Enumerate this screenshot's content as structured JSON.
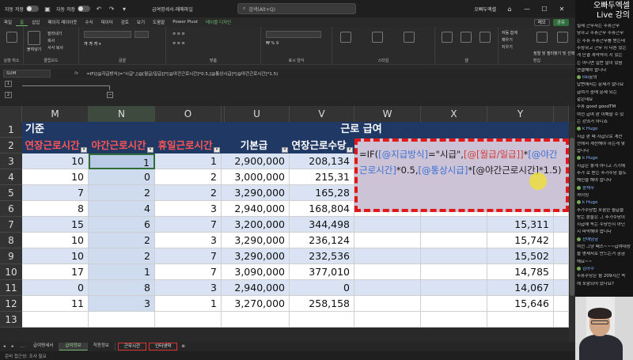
{
  "titlebar": {
    "autosave_label": "자동 저장",
    "autosave2_label": "자동 저장",
    "filename": "급여명세서-매매파일",
    "search_placeholder": "검색(Alt+Q)",
    "user": "오빠두엑셀"
  },
  "menu": [
    "파일",
    "홈",
    "삽입",
    "페이지 레이아웃",
    "수식",
    "데이터",
    "검토",
    "보기",
    "도움말",
    "Power Pivot",
    "테이블 디자인"
  ],
  "menu_active_index": 1,
  "menu_right": {
    "comment": "메모",
    "share": "공유"
  },
  "ribbon": {
    "groups": [
      {
        "label": "실행 취소",
        "buttons": []
      },
      {
        "label": "클립보드",
        "buttons": [
          "붙여넣기",
          "잘라내기",
          "복사",
          "서식 복사"
        ]
      },
      {
        "label": "글꼴",
        "buttons": []
      },
      {
        "label": "맞춤",
        "buttons": []
      },
      {
        "label": "표시 형식",
        "buttons": []
      },
      {
        "label": "스타일",
        "buttons": []
      },
      {
        "label": "셀",
        "buttons": []
      },
      {
        "label": "편집",
        "buttons": [
          "자동 합계",
          "채우기",
          "지우기",
          "정렬 및 필터",
          "찾기 및 선택"
        ]
      }
    ]
  },
  "formula_bar": {
    "name_box": "SUM",
    "fx": "fx",
    "formula": "=IF([@지급방식]=\"시급\",[@[월급/일급]]*[@야간근로시간]*0.5,[@통상시급]*[@야간근로시간]*1.5)"
  },
  "outline": {
    "levels": [
      "1",
      "2"
    ]
  },
  "columns": [
    "M",
    "N",
    "O",
    "T",
    "U",
    "V",
    "W",
    "X",
    "Y"
  ],
  "selected_column": "N",
  "row_numbers": [
    "1",
    "2",
    "3",
    "4",
    "5",
    "6",
    "7",
    "8",
    "9",
    "10",
    "11",
    "12",
    "13"
  ],
  "row1": {
    "section_left": "기준",
    "section_right": "근로 급여"
  },
  "headers": {
    "M": "연장근로시간",
    "N": "야간근로시간",
    "O": "휴일근로시간",
    "U": "기본급",
    "V": "연장근로수당"
  },
  "table": {
    "rows": [
      {
        "M": "10",
        "N": "1",
        "O": "1",
        "U": "2,900,000",
        "V": "208,134",
        "Y": ""
      },
      {
        "M": "10",
        "N": "0",
        "O": "2",
        "U": "3,000,000",
        "V": "215,31",
        "Y": ""
      },
      {
        "M": "7",
        "N": "2",
        "O": "2",
        "U": "3,290,000",
        "V": "165,28",
        "Y": ""
      },
      {
        "M": "8",
        "N": "4",
        "O": "3",
        "U": "2,940,000",
        "V": "168,804",
        "Y": ""
      },
      {
        "M": "15",
        "N": "6",
        "O": "7",
        "U": "3,200,000",
        "V": "344,498",
        "Y": "15,311"
      },
      {
        "M": "10",
        "N": "2",
        "O": "3",
        "U": "3,290,000",
        "V": "236,124",
        "Y": "15,742"
      },
      {
        "M": "10",
        "N": "2",
        "O": "7",
        "U": "3,290,000",
        "V": "232,536",
        "Y": "15,502"
      },
      {
        "M": "17",
        "N": "1",
        "O": "7",
        "U": "3,090,000",
        "V": "377,010",
        "Y": "14,785"
      },
      {
        "M": "0",
        "N": "8",
        "O": "3",
        "U": "2,940,000",
        "V": "0",
        "Y": "14,067"
      },
      {
        "M": "11",
        "N": "3",
        "O": "1",
        "U": "3,270,000",
        "V": "258,158",
        "Y": "15,646"
      }
    ]
  },
  "callout": {
    "p1": "=IF(",
    "r1": "[@지급방식]",
    "p2": "=\"시급\",",
    "r2": "[@[월급/일급]]",
    "p3": "*",
    "r3": "[@야간근로시간]",
    "p4": "*0.5,",
    "r4": "[@통상시급]",
    "p5": "*[@야간근로시간]*1.5)"
  },
  "sheet_tabs": [
    "급여명세서",
    "급여정보",
    "직원정보",
    "근무시간",
    "인터넷약"
  ],
  "sheet_active_index": 1,
  "status": "준비  접근성: 조사 필요",
  "live": {
    "title1": "오빠두엑셀",
    "title2": "Live 강의"
  },
  "chat": [
    {
      "user": "",
      "text": "실제 근무자는 주휴근무"
    },
    {
      "user": "",
      "text": "당하고 주휴근무 주휴근무"
    },
    {
      "user": "",
      "text": "는 주휴 주휴근무를 받는데"
    },
    {
      "user": "",
      "text": "주장하고 근무 시 다른 있는"
    },
    {
      "user": "",
      "text": "게 단결 계약적이 시 있는"
    },
    {
      "user": "",
      "text": "는 아니면 일반 말이 있음"
    },
    {
      "user": "",
      "text": "연결해야 합니다"
    },
    {
      "user": "tiki",
      "text": "문의"
    },
    {
      "user": "",
      "text": "답변에서는 문제가 없나요"
    },
    {
      "user": "",
      "text": "급여가 중에 문제 되는"
    },
    {
      "user": "",
      "text": "같은데요"
    },
    {
      "user": "",
      "text": "주휴 good goodTM"
    },
    {
      "user": "",
      "text": "여전 급여 판 이해할 수 있"
    },
    {
      "user": "",
      "text": "는 강의거 아니죠"
    },
    {
      "user": "k Hugo",
      "text": ""
    },
    {
      "user": "",
      "text": "시급 판 때 시급으로 계산"
    },
    {
      "user": "",
      "text": "잔에서 계산해야 하는게 맞"
    },
    {
      "user": "",
      "text": "습니다"
    },
    {
      "user": "k Hugo",
      "text": ""
    },
    {
      "user": "",
      "text": "시급은 좋게 아니고 기기에"
    },
    {
      "user": "",
      "text": "추가 로 받는 추가수당 들도"
    },
    {
      "user": "",
      "text": "해진을 해야 합니다"
    },
    {
      "user": "송채우",
      "text": ""
    },
    {
      "user": "",
      "text": "까이밍"
    },
    {
      "user": "k Hugo",
      "text": ""
    },
    {
      "user": "",
      "text": "추가수당법 포함한 월급을"
    },
    {
      "user": "",
      "text": "받는 분들은 그 추가수당이"
    },
    {
      "user": "",
      "text": "시급에 녹는 수당인지 아닌"
    },
    {
      "user": "",
      "text": "지 파악해야 합니다"
    },
    {
      "user": "선애남궁",
      "text": ""
    },
    {
      "user": "",
      "text": "여전 그냥 패스~~~급여대장"
    },
    {
      "user": "",
      "text": "을 명세서로 만드는거 궁금"
    },
    {
      "user": "",
      "text": "해요~~"
    },
    {
      "user": "김하수",
      "text": ""
    },
    {
      "user": "",
      "text": "주휴수당은 월 209시간 속"
    },
    {
      "user": "",
      "text": "에 포함되어 있나요?"
    }
  ],
  "colors": {
    "header_dark": "#1f3864",
    "header_red_text": "#ff5555",
    "band_light": "#dae3f3",
    "selection": "#cfdcef",
    "callout_border": "#e01818",
    "callout_bg": "#cdc3d7",
    "accent_green": "#6fb96f"
  }
}
